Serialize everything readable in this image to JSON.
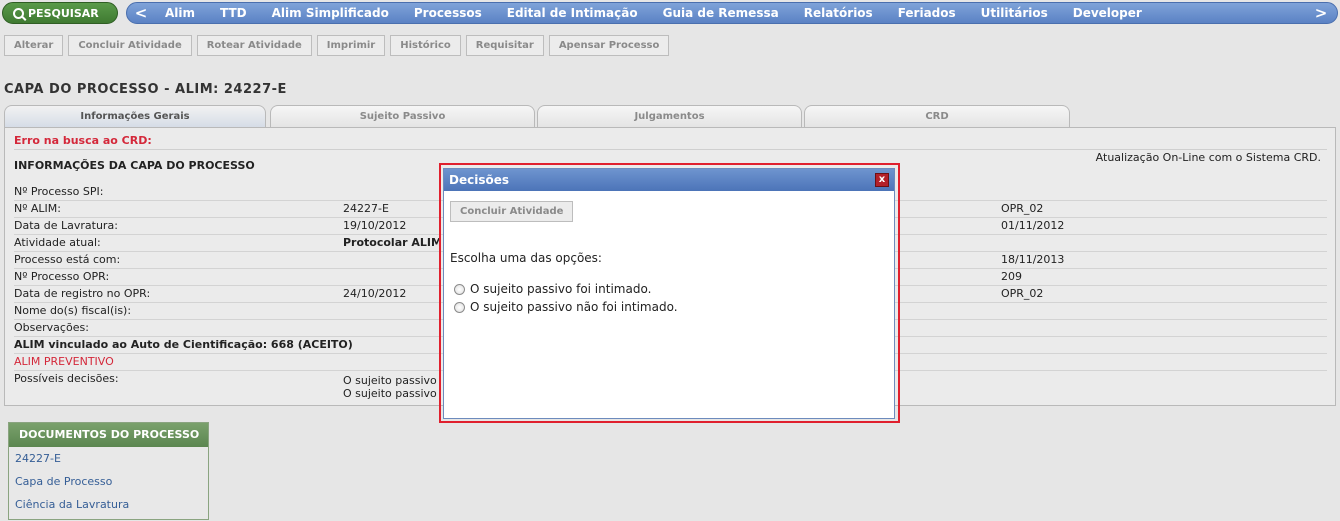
{
  "nav": {
    "search_label": "PESQUISAR",
    "left_arrow": "<",
    "right_arrow": ">",
    "items": [
      "Alim",
      "TTD",
      "Alim Simplificado",
      "Processos",
      "Edital de Intimação",
      "Guia de Remessa",
      "Relatórios",
      "Feriados",
      "Utilitários",
      "Developer"
    ]
  },
  "toolbar": [
    "Alterar",
    "Concluir Atividade",
    "Rotear Atividade",
    "Imprimir",
    "Histórico",
    "Requisitar",
    "Apensar Processo"
  ],
  "page_title": "CAPA DO PROCESSO - ALIM: 24227-E",
  "tabs": [
    "Informações Gerais",
    "Sujeito Passivo",
    "Julgamentos",
    "CRD"
  ],
  "panel": {
    "error": "Erro na busca ao CRD:",
    "section_title": "INFORMAÇÕES DA CAPA DO PROCESSO",
    "sync_text": "Atualização On-Line com o Sistema CRD.",
    "rows": [
      {
        "label": "Nº Processo SPI:",
        "value": "",
        "right": ""
      },
      {
        "label": "Nº ALIM:",
        "value": "24227-E",
        "right": "OPR_02"
      },
      {
        "label": "Data de Lavratura:",
        "value": "19/10/2012",
        "right": "01/11/2012"
      },
      {
        "label": "Atividade atual:",
        "value": "Protocolar ALIM",
        "right": ""
      },
      {
        "label": "Processo está com:",
        "value": "",
        "right": "18/11/2013"
      },
      {
        "label": "Nº Processo OPR:",
        "value": "",
        "right": "209"
      },
      {
        "label": "Data de registro no OPR:",
        "value": "24/10/2012",
        "right": "OPR_02"
      },
      {
        "label": "Nome do(s) fiscal(is):",
        "value": "",
        "right": ""
      },
      {
        "label": "Observações:",
        "value": "",
        "right": ""
      }
    ],
    "linked": "ALIM vinculado ao Auto de Cientificação: 668 (ACEITO)",
    "preventive": "ALIM PREVENTIVO",
    "decisions_label": "Possíveis decisões:",
    "decisions_values": [
      "O sujeito passivo",
      "O sujeito passivo"
    ]
  },
  "documents": {
    "title": "DOCUMENTOS DO PROCESSO",
    "links": [
      "24227-E",
      "Capa de Processo",
      "Ciência da Lavratura"
    ]
  },
  "modal": {
    "title": "Decisões",
    "close": "x",
    "action": "Concluir Atividade",
    "question": "Escolha uma das opções:",
    "options": [
      "O sujeito passivo foi intimado.",
      "O sujeito passivo não foi intimado."
    ]
  }
}
